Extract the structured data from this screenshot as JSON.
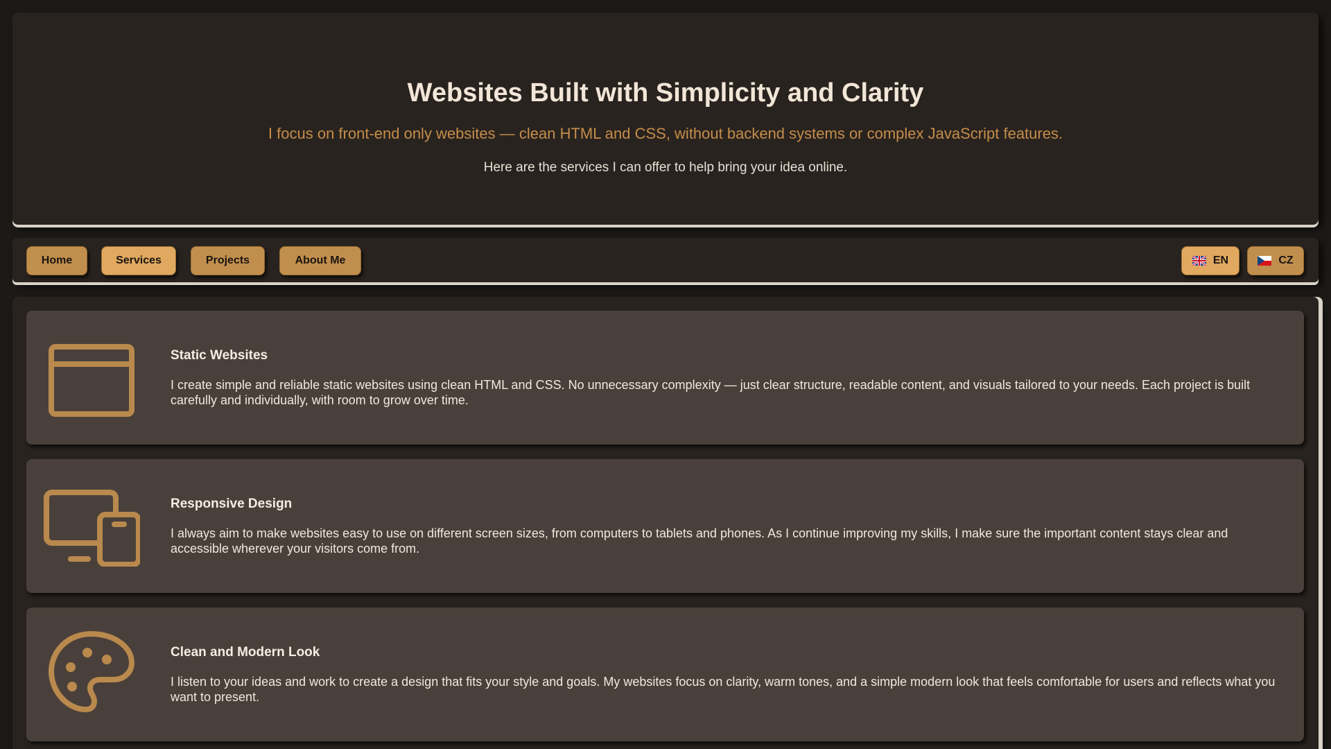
{
  "header": {
    "title": "Websites Built with Simplicity and Clarity",
    "subtitle": "I focus on front-end only websites — clean HTML and CSS, without backend systems or complex JavaScript features.",
    "intro": "Here are the services I can offer to help bring your idea online."
  },
  "nav": {
    "items": [
      {
        "label": "Home",
        "active": false
      },
      {
        "label": "Services",
        "active": true
      },
      {
        "label": "Projects",
        "active": false
      },
      {
        "label": "About Me",
        "active": false
      }
    ],
    "languages": [
      {
        "code": "EN",
        "flag": "uk-flag-icon",
        "active": true
      },
      {
        "code": "CZ",
        "flag": "czech-flag-icon",
        "active": false
      }
    ]
  },
  "services": [
    {
      "icon": "browser-window-icon",
      "title": "Static Websites",
      "description": "I create simple and reliable static websites using clean HTML and CSS. No unnecessary complexity — just clear structure, readable content, and visuals tailored to your needs. Each project is built carefully and individually, with room to grow over time."
    },
    {
      "icon": "devices-icon",
      "title": "Responsive Design",
      "description": "I always aim to make websites easy to use on different screen sizes, from computers to tablets and phones. As I continue improving my skills, I make sure the important content stays clear and accessible wherever your visitors come from."
    },
    {
      "icon": "palette-icon",
      "title": "Clean and Modern Look",
      "description": "I listen to your ideas and work to create a design that fits your style and goals. My websites focus on clarity, warm tones, and a simple modern look that feels comfortable for users and reflects what you want to present."
    }
  ],
  "colors": {
    "background": "#1c1917",
    "panel": "#29231f",
    "card": "#4a403b",
    "accent": "#c18f4d",
    "accent_active": "#e0a95f",
    "subtitle": "#c58d4a"
  }
}
